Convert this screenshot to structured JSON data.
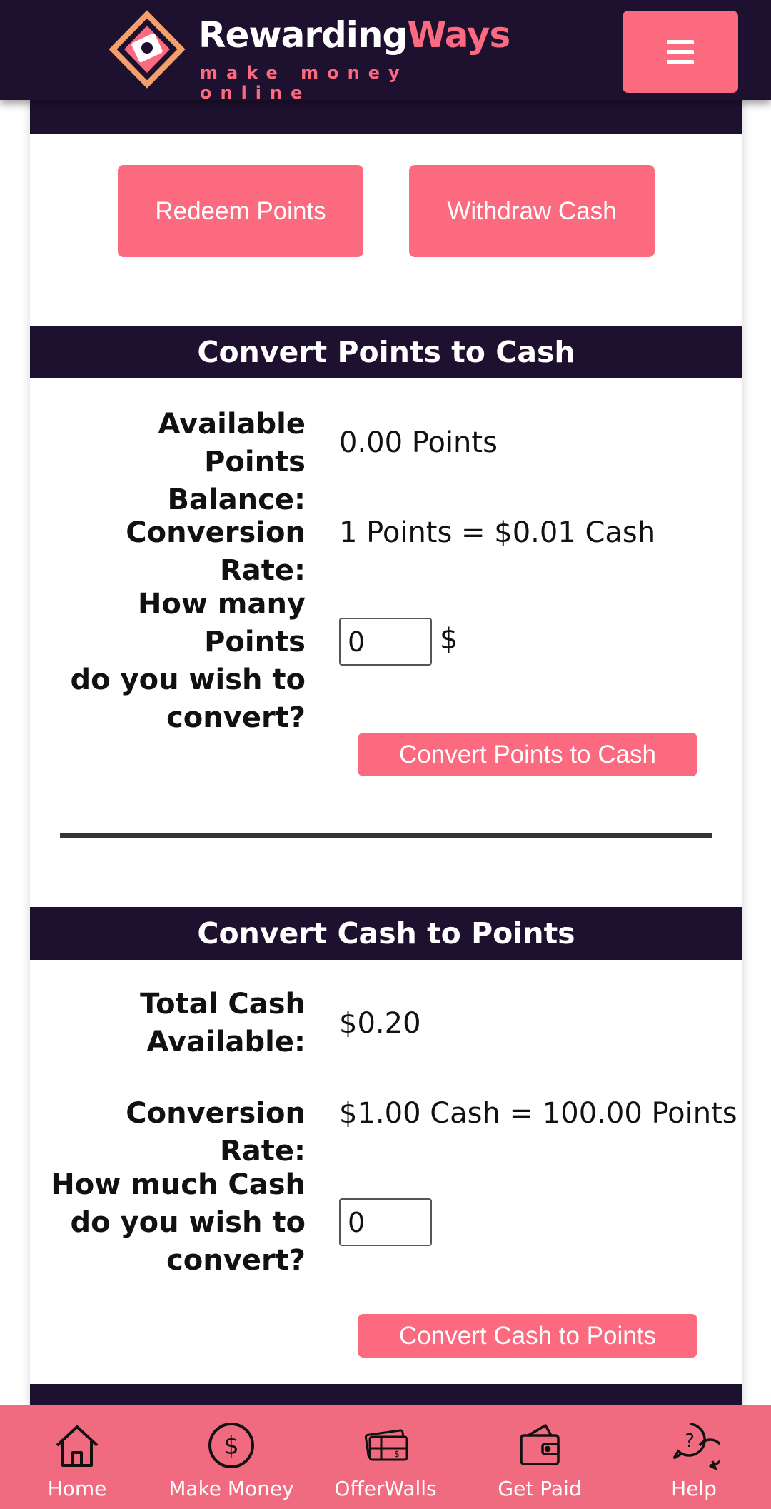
{
  "brand": {
    "name_part1": "Rewarding",
    "name_part2": "Ways",
    "tagline": "make money online",
    "accent_color": "#fc6a80",
    "dark_color": "#1e1130"
  },
  "actions": {
    "redeem_label": "Redeem Points",
    "withdraw_label": "Withdraw Cash"
  },
  "points_to_cash": {
    "heading": "Convert Points to Cash",
    "balance_label_line1": "Available Points",
    "balance_label_line2": "Balance:",
    "balance_value": "0.00 Points",
    "rate_label": "Conversion Rate:",
    "rate_value": "1 Points = $0.01 Cash",
    "amount_label_line1": "How many Points",
    "amount_label_line2": "do you wish to",
    "amount_label_line3": "convert?",
    "amount_value": "0",
    "currency_symbol": "$",
    "submit_label": "Convert Points to Cash"
  },
  "cash_to_points": {
    "heading": "Convert Cash to Points",
    "balance_label_line1": "Total Cash",
    "balance_label_line2": "Available:",
    "balance_value": "$0.20",
    "rate_label": "Conversion Rate:",
    "rate_value": "$1.00 Cash = 100.00 Points",
    "amount_label_line1": "How much Cash",
    "amount_label_line2": "do you wish to",
    "amount_label_line3": "convert?",
    "amount_value": "0",
    "submit_label": "Convert Cash to Points"
  },
  "bottom_nav": {
    "items": [
      {
        "label": "Home",
        "icon": "home-icon"
      },
      {
        "label": "Make Money",
        "icon": "dollar-circle-icon"
      },
      {
        "label": "OfferWalls",
        "icon": "gift-card-icon"
      },
      {
        "label": "Get Paid",
        "icon": "wallet-icon"
      },
      {
        "label": "Help",
        "icon": "help-chat-icon"
      }
    ]
  }
}
